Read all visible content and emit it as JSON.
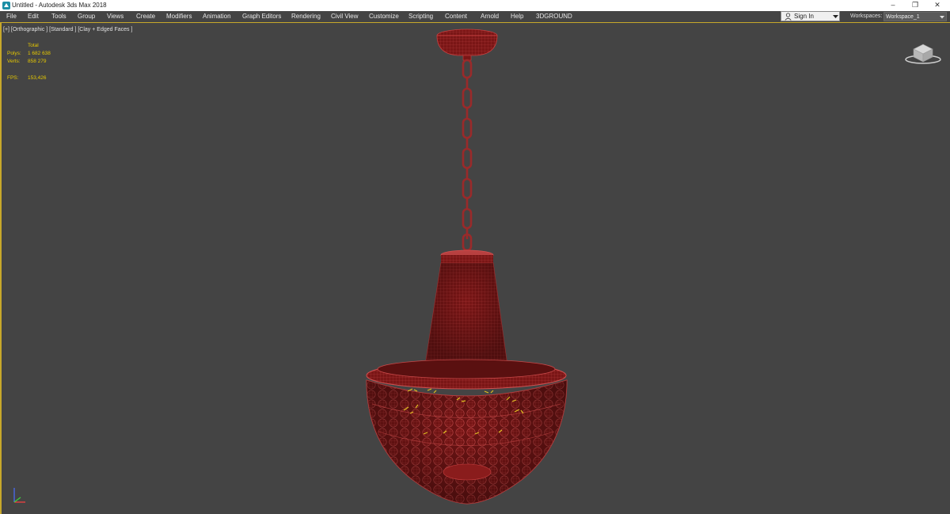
{
  "window": {
    "title": "Untitled - Autodesk 3ds Max 2018",
    "minimize": "–",
    "restore": "❐",
    "close": "✕"
  },
  "menu": {
    "items": [
      "File",
      "Edit",
      "Tools",
      "Group",
      "Views",
      "Create",
      "Modifiers",
      "Animation",
      "Graph Editors",
      "Rendering",
      "Civil View",
      "Customize",
      "Scripting",
      "Content",
      "Arnold",
      "Help",
      "3DGROUND"
    ]
  },
  "account": {
    "sign_in": "Sign In"
  },
  "workspaces": {
    "label": "Workspaces:",
    "value": "Workspace_1"
  },
  "viewport": {
    "label": "[+] [Orthographic ] [Standard ] [Clay + Edged Faces ]",
    "stats": {
      "total_label": "Total",
      "polys_label": "Polys:",
      "polys_value": "1 682 638",
      "verts_label": "Verts:",
      "verts_value": "858 279",
      "fps_label": "FPS:",
      "fps_value": "153,426"
    }
  },
  "icons": {
    "app": "3dsmax-app-icon",
    "user": "user-icon",
    "dropdown": "chevron-down-icon",
    "viewcube": "viewcube-icon",
    "axis": "axis-tripod-icon"
  },
  "colors": {
    "background": "#444444",
    "accent": "#c7a82a",
    "stats_text": "#e6c800",
    "model": "#8a1a1a",
    "model_edge": "#c84040"
  }
}
